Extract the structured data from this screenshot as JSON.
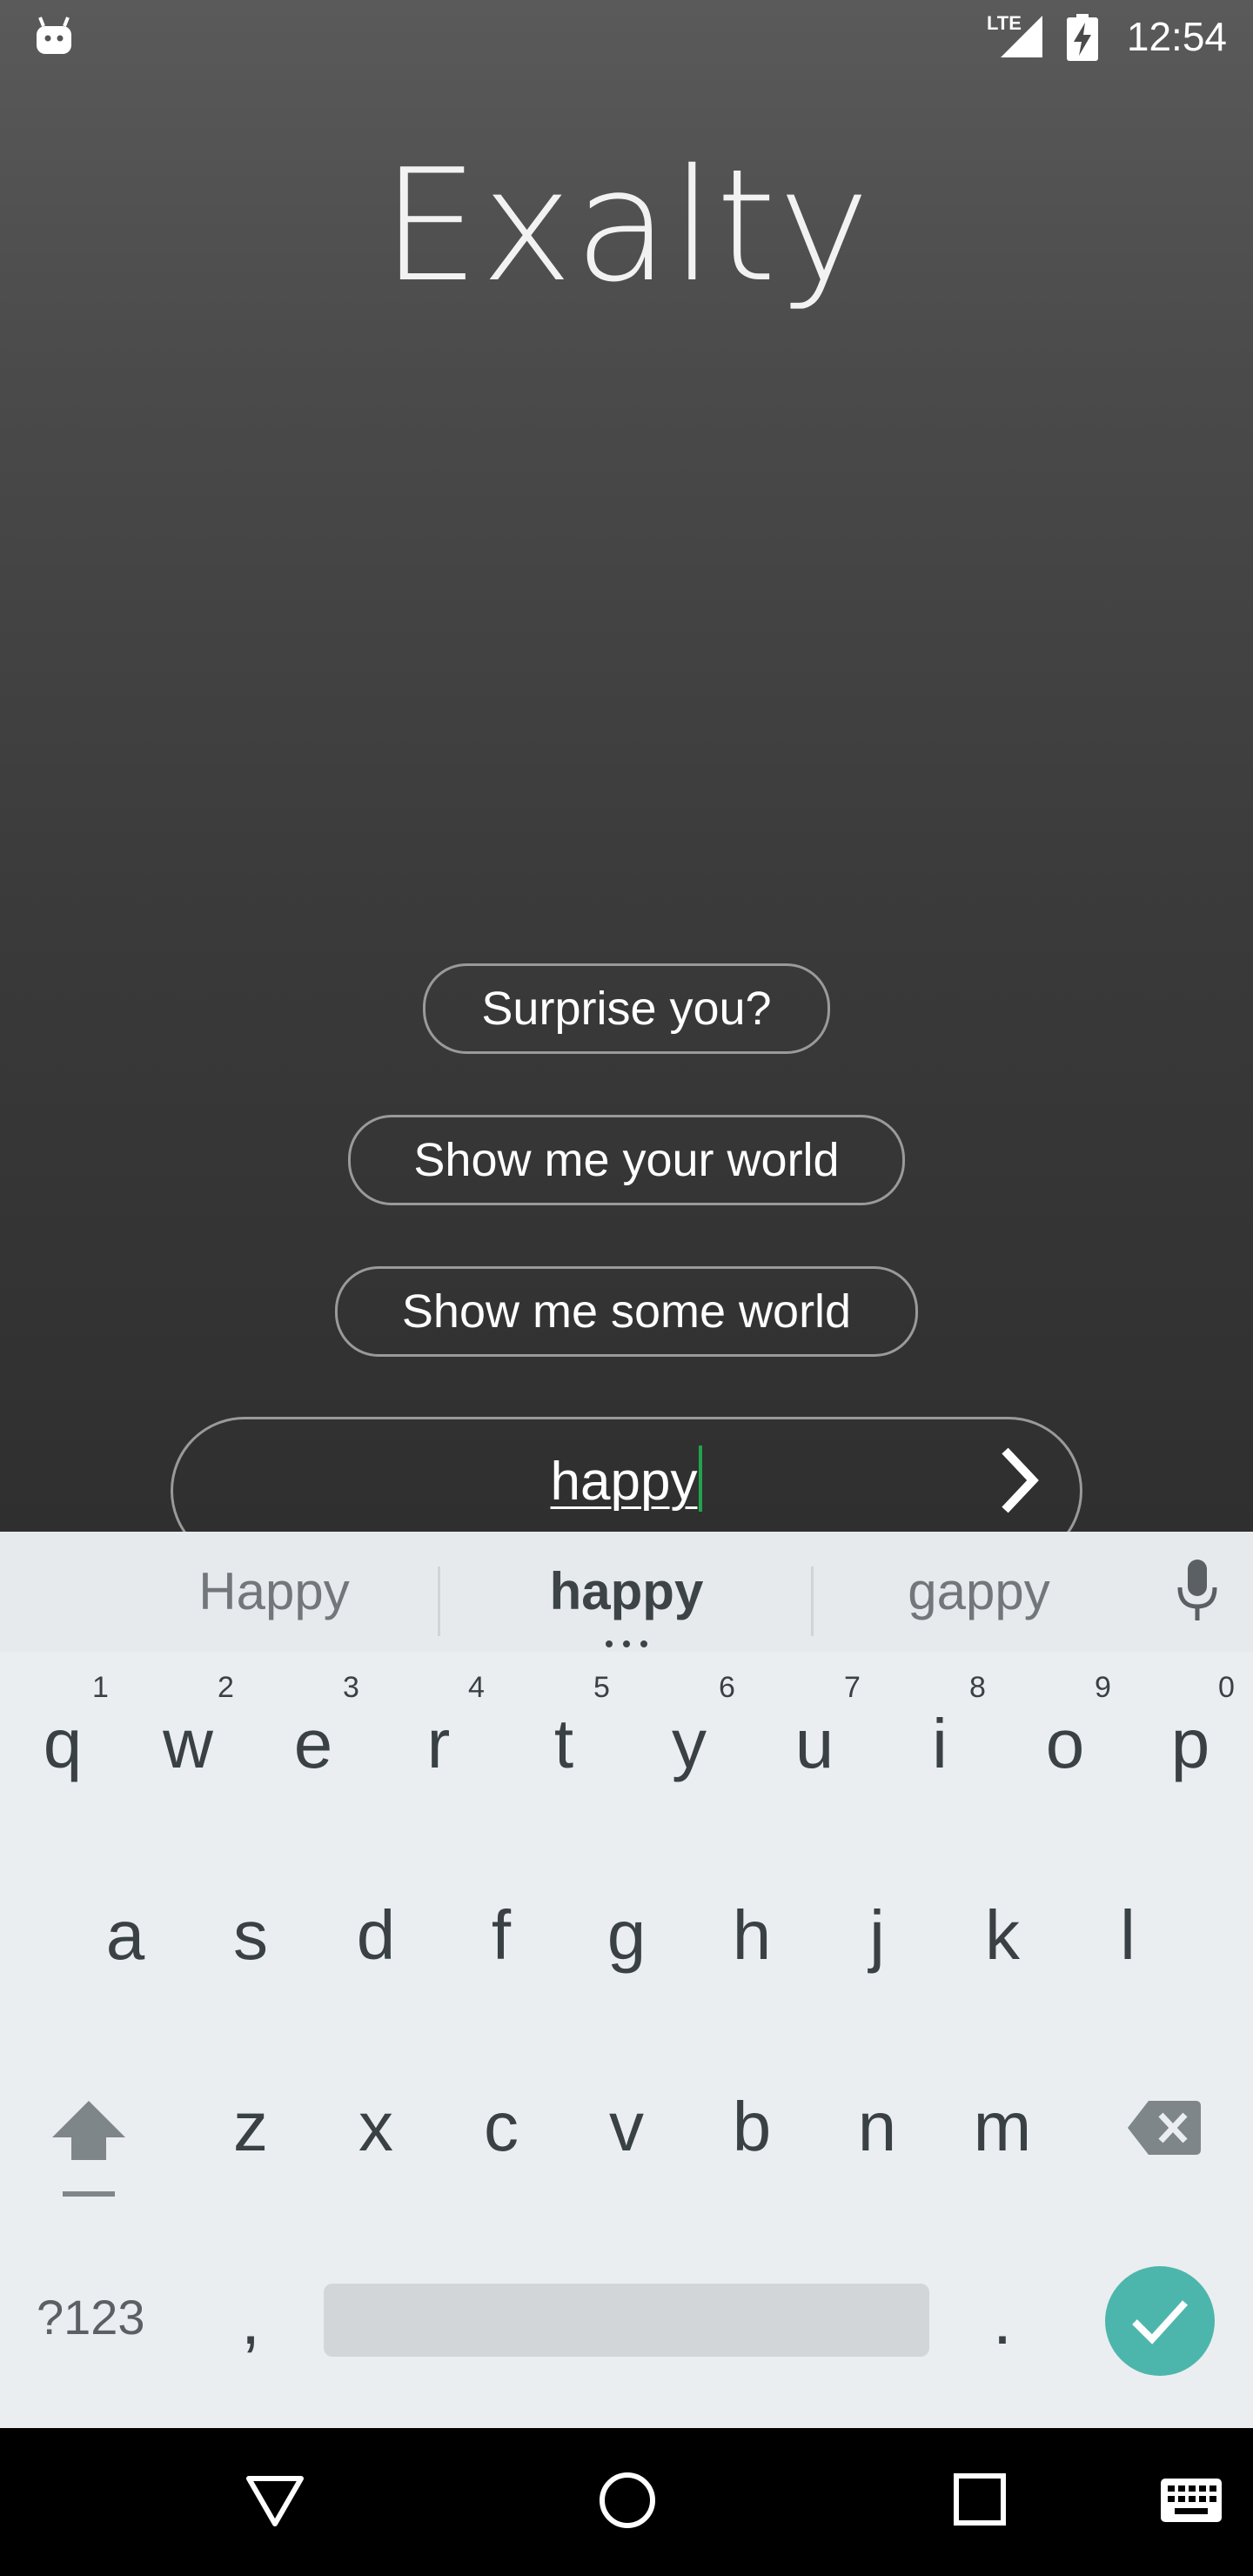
{
  "status_bar": {
    "network": "LTE",
    "time": "12:54"
  },
  "app": {
    "title": "Exalty",
    "chips": [
      "Surprise you?",
      "Show me your world",
      "Show me some world"
    ],
    "input": {
      "value": "happy"
    }
  },
  "keyboard": {
    "suggestions": [
      "Happy",
      "happy",
      "gappy"
    ],
    "row1": [
      "q",
      "w",
      "e",
      "r",
      "t",
      "y",
      "u",
      "i",
      "o",
      "p"
    ],
    "row1_hints": [
      "1",
      "2",
      "3",
      "4",
      "5",
      "6",
      "7",
      "8",
      "9",
      "0"
    ],
    "row2": [
      "a",
      "s",
      "d",
      "f",
      "g",
      "h",
      "j",
      "k",
      "l"
    ],
    "row3": [
      "z",
      "x",
      "c",
      "v",
      "b",
      "n",
      "m"
    ],
    "mode_label": "?123",
    "comma": ",",
    "period": "."
  },
  "colors": {
    "accent_enter": "#4db6ac",
    "cursor": "#21a34d"
  }
}
